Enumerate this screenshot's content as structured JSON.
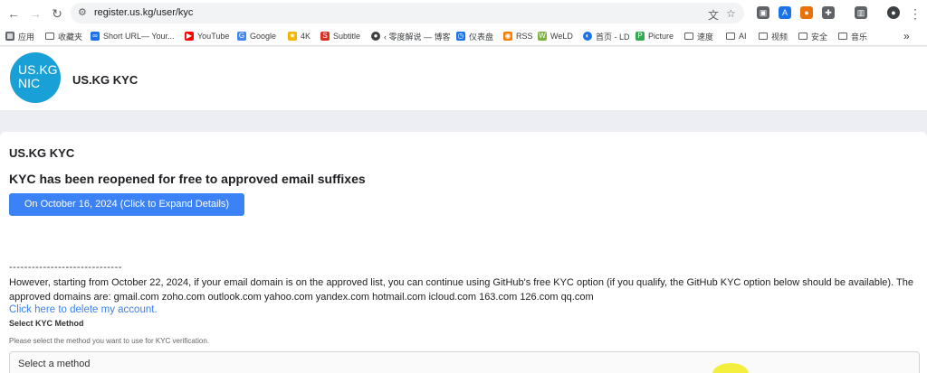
{
  "browser": {
    "url": "register.us.kg/user/kyc",
    "bookmarks": [
      {
        "label": "应用",
        "icon": "apps-grid-icon",
        "color": "#5f6368"
      },
      {
        "label": "收藏夹",
        "icon": "folder-icon"
      },
      {
        "label": "Short URL— Your...",
        "icon": "link-icon",
        "color": "#1a73e8"
      },
      {
        "label": "YouTube",
        "icon": "youtube-icon",
        "color": "#ff0000"
      },
      {
        "label": "Google",
        "icon": "google-icon",
        "color": "#4285f4"
      },
      {
        "label": "4K",
        "icon": "4k-icon",
        "color": "#f5b400"
      },
      {
        "label": "Subtitle",
        "icon": "subtitle-icon",
        "color": "#d93025"
      },
      {
        "label": "‹ 零度解说 — 博客",
        "icon": "blog-icon",
        "color": "#3c4043"
      },
      {
        "label": "仪表盘",
        "icon": "dashboard-icon",
        "color": "#1a73e8"
      },
      {
        "label": "RSS",
        "icon": "rss-icon",
        "color": "#f57c00"
      },
      {
        "label": "WeLD",
        "icon": "weld-icon",
        "color": "#7cb342"
      },
      {
        "label": "首页 - LD",
        "icon": "ld-icon",
        "color": "#1a73e8"
      },
      {
        "label": "Picture",
        "icon": "picture-icon",
        "color": "#34a853"
      },
      {
        "label": "速度",
        "icon": "folder-icon"
      },
      {
        "label": "AI",
        "icon": "folder-icon"
      },
      {
        "label": "视频",
        "icon": "folder-icon"
      },
      {
        "label": "安全",
        "icon": "folder-icon"
      },
      {
        "label": "音乐",
        "icon": "folder-icon"
      }
    ],
    "more_bookmarks": "»"
  },
  "site": {
    "logo_line1": "US.KG",
    "logo_line2": "NIC",
    "title": "US.KG KYC",
    "brand_color": "#19a0d6"
  },
  "card": {
    "title": "US.KG KYC",
    "heading": "KYC has been reopened for free to approved email suffixes",
    "expand_button": "On October 16, 2024 (Click to Expand Details)",
    "divider": "------------------------------",
    "notice": "However, starting from October 22, 2024, if your email domain is on the approved list, you can continue using GitHub's free KYC option (if you qualify, the GitHub KYC option below should be available). The approved domains are: gmail.com zoho.com outlook.com yahoo.com yandex.com hotmail.com icloud.com 163.com 126.com qq.com",
    "delete_link": "Click here to delete my account.",
    "method_label": "Select KYC Method",
    "method_help": "Please select the method you want to use for KYC verification.",
    "method_placeholder": "Select a method",
    "accent_color": "#3b82f6"
  }
}
